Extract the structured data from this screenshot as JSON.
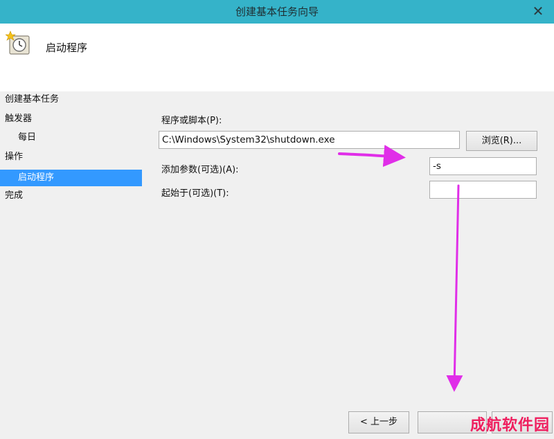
{
  "window": {
    "title": "创建基本任务向导",
    "close_label": "✕"
  },
  "header": {
    "title": "启动程序",
    "icon": "task-clock-icon"
  },
  "sidebar": {
    "items": [
      {
        "label": "创建基本任务",
        "selected": false
      },
      {
        "label": "触发器",
        "selected": false
      },
      {
        "label": "每日",
        "selected": false
      },
      {
        "label": "操作",
        "selected": false
      },
      {
        "label": "启动程序",
        "selected": true
      },
      {
        "label": "完成",
        "selected": false
      }
    ]
  },
  "form": {
    "program_label": "程序或脚本(P):",
    "program_value": "C:\\Windows\\System32\\shutdown.exe",
    "browse_label": "浏览(R)...",
    "args_label": "添加参数(可选)(A):",
    "args_value": "-s",
    "start_in_label": "起始于(可选)(T):",
    "start_in_value": ""
  },
  "footer": {
    "back_label": "< 上一步"
  },
  "watermark": {
    "text": "成航软件园"
  },
  "colors": {
    "titlebar": "#35b3c9",
    "selection": "#3399ff",
    "arrow": "#e02ee8",
    "watermark": "#ef1f5f"
  }
}
